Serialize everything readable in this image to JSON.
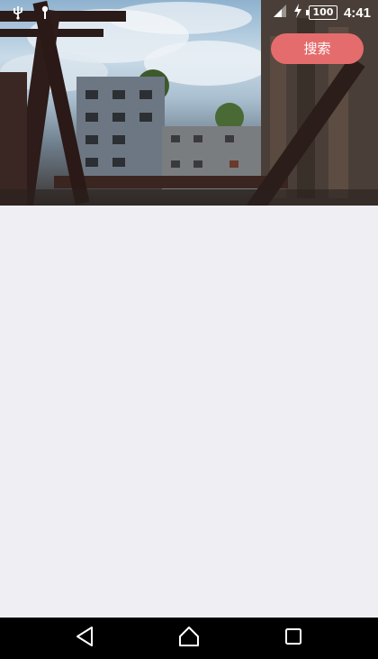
{
  "status_bar": {
    "left_icons": [
      "usb-icon",
      "download-icon"
    ],
    "right_icons": [
      "signal-icon",
      "charging-icon",
      "battery-icon"
    ],
    "battery_level": "100",
    "time": "4:41"
  },
  "hero": {
    "image": "ruined-building-scene"
  },
  "search_button": {
    "label": "搜索",
    "color": "#e56c6c"
  },
  "nav_bar": {
    "buttons": [
      "back-icon",
      "home-icon",
      "recents-icon"
    ]
  },
  "colors": {
    "background": "#efeff3",
    "nav_bar": "#000000",
    "accent": "#e56c6c"
  }
}
